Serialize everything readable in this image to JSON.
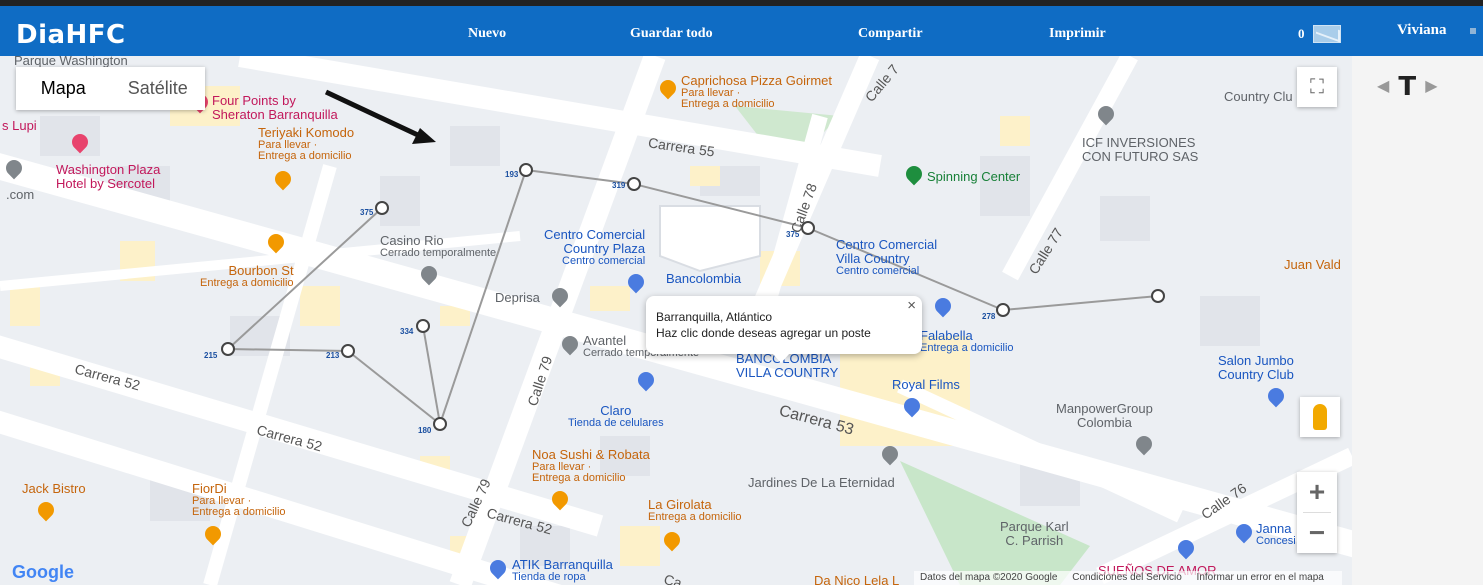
{
  "header": {
    "brand": "DiaHFC",
    "nav": [
      "Nuevo",
      "Guardar todo",
      "Compartir",
      "Imprimir"
    ],
    "message_count": "0",
    "user": "Viviana"
  },
  "map_controls": {
    "map_label": "Mapa",
    "satellite_label": "Satélite",
    "fullscreen": "⛶",
    "zoom_in": "+",
    "zoom_out": "−"
  },
  "infowindow": {
    "line1": "Barranquilla, Atlántico",
    "line2": "Haz clic donde deseas agregar un poste",
    "close": "×"
  },
  "node_labels": [
    "193",
    "319",
    "375",
    "375",
    "278",
    "215",
    "213",
    "334",
    "180"
  ],
  "places": {
    "parque_washington": "Parque Washington",
    "four_points": "Four Points by",
    "four_points2": "Sheraton Barranquilla",
    "lupi": "s Lupi",
    "teriyaki": "Teriyaki Komodo",
    "teriyaki_sub1": "Para llevar ·",
    "teriyaki_sub2": "Entrega a domicilio",
    "washington_plaza": "Washington Plaza",
    "washington_plaza2": "Hotel by Sercotel",
    "com": ".com",
    "caprichosa": "Caprichosa Pizza Goirmet",
    "caprichosa_sub1": "Para llevar ·",
    "caprichosa_sub2": "Entrega a domicilio",
    "carrera55": "Carrera 55",
    "spinning": "Spinning Center",
    "icf1": "ICF INVERSIONES",
    "icf2": "CON FUTURO SAS",
    "country_clu": "Country Clu",
    "casino": "Casino Rio",
    "casino_sub": "Cerrado temporalmente",
    "cc_country_plaza1": "Centro Comercial",
    "cc_country_plaza2": "Country Plaza",
    "cc_country_plaza_sub": "Centro comercial",
    "bancolombia": "Bancolombia",
    "cc_villa1": "Centro Comercial",
    "cc_villa2": "Villa Country",
    "cc_villa_sub": "Centro comercial",
    "bourbon": "Bourbon St",
    "bourbon_sub": "Entrega a domicilio",
    "deprisa": "Deprisa",
    "juan_vald": "Juan Vald",
    "avantel": "Avantel",
    "avantel_sub": "Cerrado temporalmente",
    "falabella": "Falabella",
    "falabella_sub": "Entrega a domicilio",
    "banco_villa1": "BANCOLOMBIA",
    "banco_villa2": "VILLA COUNTRY",
    "royal": "Royal Films",
    "salon1": "Salon Jumbo",
    "salon2": "Country Club",
    "carrera52a": "Carrera 52",
    "calle79a": "Calle 79",
    "claro": "Claro",
    "claro_sub": "Tienda de celulares",
    "carrera53": "Carrera 53",
    "manpower1": "ManpowerGroup",
    "manpower2": "Colombia",
    "carrera52b": "Carrera 52",
    "noa": "Noa Sushi & Robata",
    "noa_sub1": "Para llevar ·",
    "noa_sub2": "Entrega a domicilio",
    "jardines": "Jardines De La Eternidad",
    "jack": "Jack Bistro",
    "fiordi": "FiorDi",
    "fiordi_sub1": "Para llevar ·",
    "fiordi_sub2": "Entrega a domicilio",
    "calle79b": "Calle 79",
    "girolata": "La Girolata",
    "girolata_sub": "Entrega a domicilio",
    "carrera52c": "Carrera 52",
    "calle76": "Calle 76",
    "parque_karl1": "Parque Karl",
    "parque_karl2": "C. Parrish",
    "janna": "Janna",
    "janna_sub": "Concesi",
    "atik": "ATIK Barranquilla",
    "atik_sub": "Tienda de ropa",
    "calle78": "Calle 78",
    "calle77": "Calle 77",
    "calle7x": "Calle 7",
    "ca": "Ca",
    "da_nico": "Da Nico Lela L",
    "suenos": "SUEÑOS DE AMOR"
  },
  "attribution": {
    "data": "Datos del mapa ©2020 Google",
    "terms": "Condiciones del Servicio",
    "report": "Informar un error en el mapa"
  },
  "google_logo": "Google",
  "side_nav": {
    "prev": "◀",
    "label": "T",
    "next": "▶"
  }
}
